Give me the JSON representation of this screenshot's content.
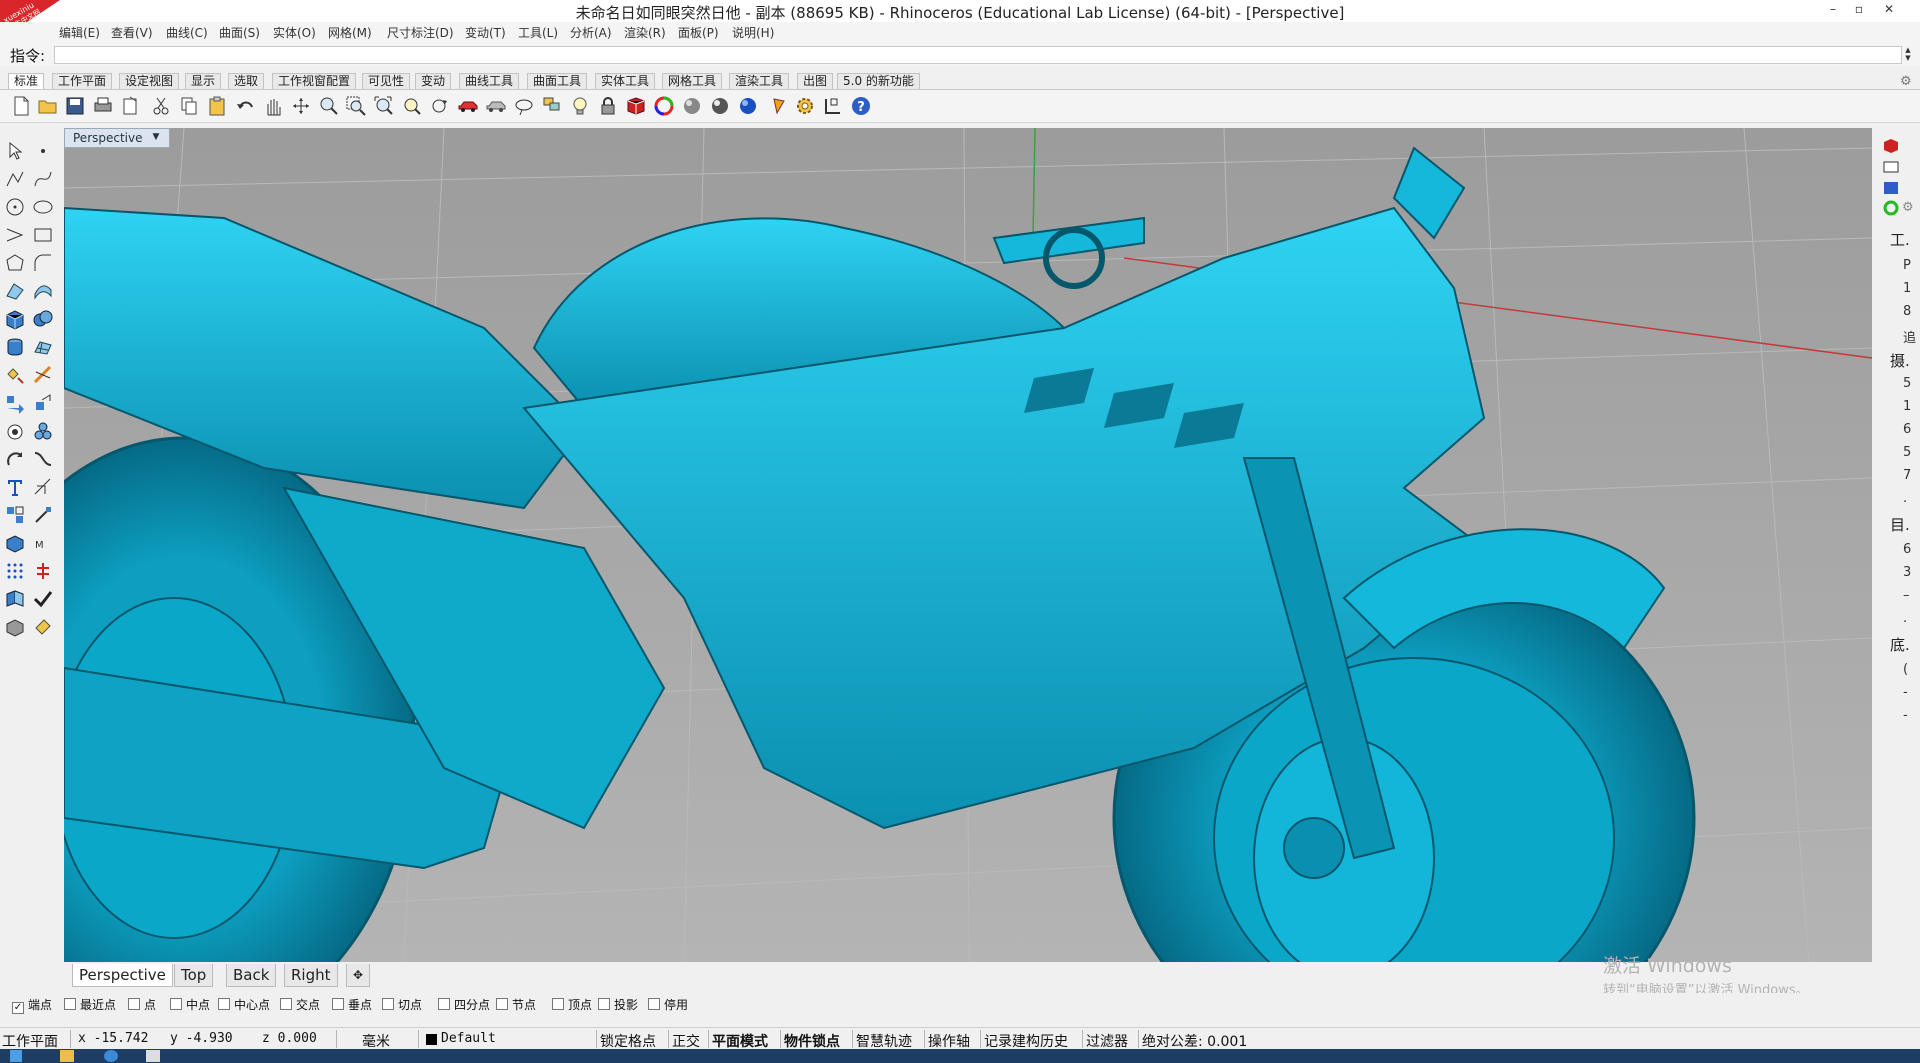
{
  "window": {
    "title": "未命名日如同眼突然日他 - 副本 (88695 KB) - Rhinoceros (Educational Lab License) (64-bit) - [Perspective]",
    "logo_text": "xuexiniu 学犀牛中文网",
    "controls": [
      "–",
      "▫",
      "✕"
    ]
  },
  "menu": [
    "编辑(E)",
    "查看(V)",
    "曲线(C)",
    "曲面(S)",
    "实体(O)",
    "网格(M)",
    "尺寸标注(D)",
    "变动(T)",
    "工具(L)",
    "分析(A)",
    "渲染(R)",
    "面板(P)",
    "说明(H)"
  ],
  "command": {
    "label": "指令:",
    "value": ""
  },
  "toolbar_tabs": [
    "标准",
    "工作平面",
    "设定视图",
    "显示",
    "选取",
    "工作视窗配置",
    "可见性",
    "变动",
    "曲线工具",
    "曲面工具",
    "实体工具",
    "网格工具",
    "渲染工具",
    "出图",
    "5.0 的新功能"
  ],
  "icons_top": [
    "new-file-icon",
    "open-folder-icon",
    "save-icon",
    "print-icon",
    "import-icon",
    "cut-icon",
    "copy-icon",
    "paste-icon",
    "undo-icon",
    "pan-hand-icon",
    "rotate-view-icon",
    "zoom-dynamic-icon",
    "zoom-window-icon",
    "zoom-extents-icon",
    "zoom-selected-icon",
    "rotate-camera-icon",
    "car-icon",
    "shaded-car-icon",
    "lasso-icon",
    "layers-icon",
    "lightbulb-icon",
    "lock-icon",
    "materials-icon",
    "color-wheel-icon",
    "sphere-gray-icon",
    "sphere-shaded-icon",
    "sphere-blue-icon",
    "render-pen-icon",
    "settings-gear-icon",
    "snap-grid-icon",
    "help-icon"
  ],
  "viewport": {
    "name": "Perspective",
    "model_color": "#12b6d8",
    "grid_color": "#b6b6b6",
    "x_axis_color": "#c43a3a",
    "y_axis_color": "#3aa33a"
  },
  "view_tabs": [
    "Perspective",
    "Top",
    "Back",
    "Right",
    "✥"
  ],
  "activation_watermark": {
    "title": "激活 Windows",
    "subtitle": "转到“电脑设置”以激活 Windows。"
  },
  "osnaps": [
    {
      "label": "端点",
      "checked": true
    },
    {
      "label": "最近点",
      "checked": false
    },
    {
      "label": "点",
      "checked": false
    },
    {
      "label": "中点",
      "checked": false
    },
    {
      "label": "中心点",
      "checked": false
    },
    {
      "label": "交点",
      "checked": false
    },
    {
      "label": "垂点",
      "checked": false
    },
    {
      "label": "切点",
      "checked": false
    },
    {
      "label": "四分点",
      "checked": false
    },
    {
      "label": "节点",
      "checked": false
    },
    {
      "label": "顶点",
      "checked": false
    },
    {
      "label": "投影",
      "checked": false
    },
    {
      "label": "停用",
      "checked": false
    }
  ],
  "status": {
    "cplane": "工作平面",
    "x": "x -15.742",
    "y": "y -4.930",
    "z": "z 0.000",
    "units": "毫米",
    "layer": "Default",
    "grid_snap": "锁定格点",
    "ortho": "正交",
    "planar": "平面模式",
    "osnap": "物件锁点",
    "smarttrack": "智慧轨迹",
    "gumball": "操作轴",
    "history": "记录建构历史",
    "filter": "过滤器",
    "tolerance": "绝对公差: 0.001"
  },
  "right_panel_chars": [
    "工.",
    "P",
    "1",
    "8",
    "追",
    "摄.",
    "5",
    "1",
    "6",
    "5",
    "7",
    ".",
    "目.",
    "6",
    "3",
    "–",
    ".",
    "底.",
    "(",
    "-",
    "-"
  ]
}
